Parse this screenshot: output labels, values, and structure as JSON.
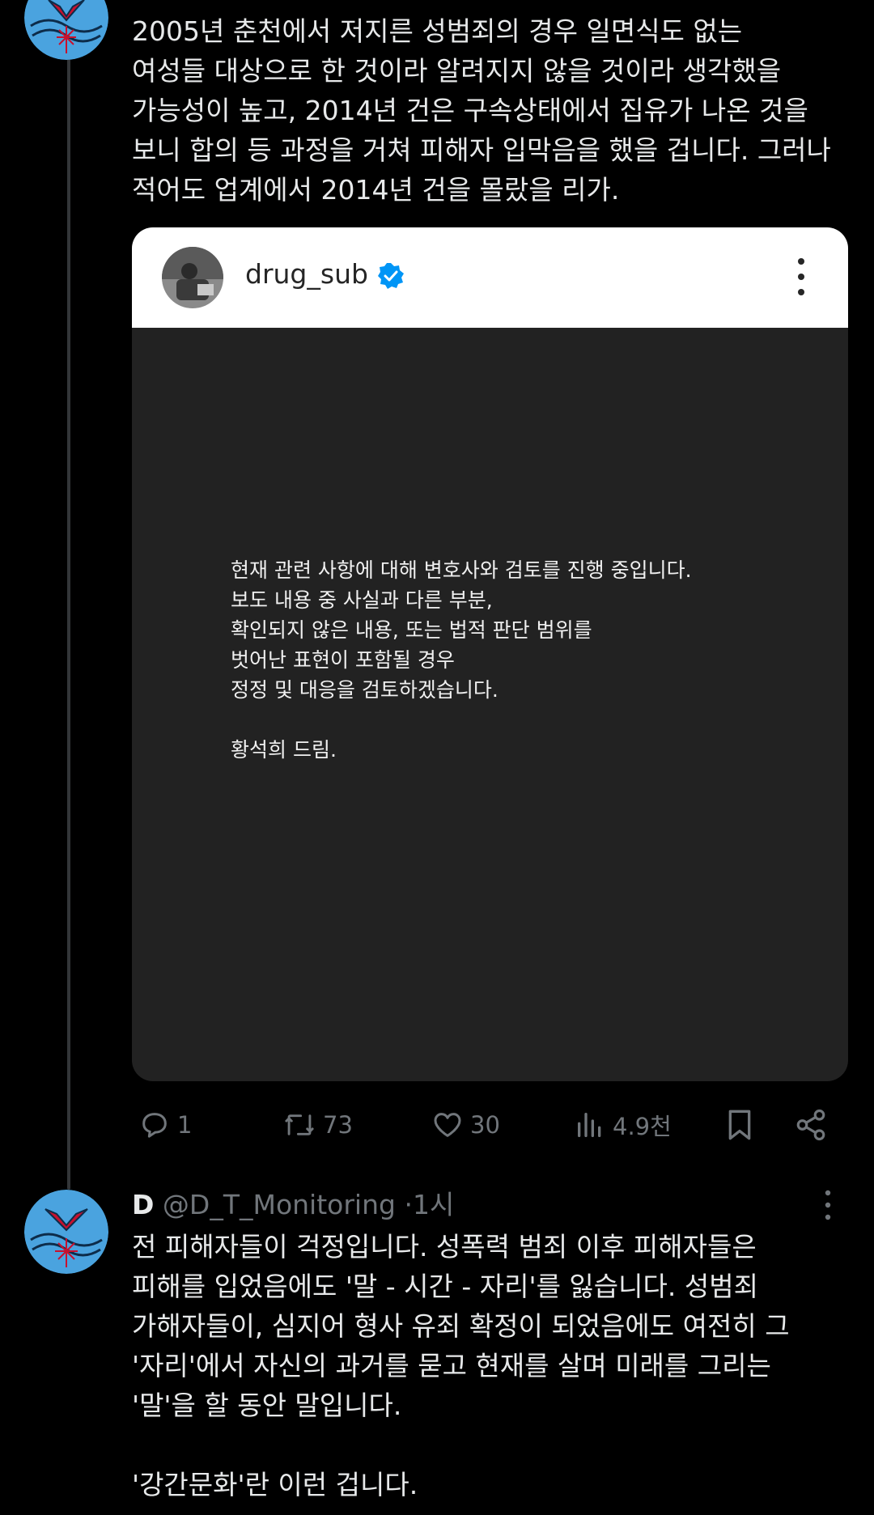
{
  "tweet1": {
    "text": "2005년 춘천에서 저지른 성범죄의 경우 일면식도 없는\n여성들 대상으로 한 것이라 알려지지 않을 것이라 생각했을\n가능성이 높고, 2014년 건은 구속상태에서 집유가 나온 것을\n보니 합의 등 과정을 거쳐 피해자 입막음을 했을 겁니다. 그러나\n적어도 업계에서 2014년 건을 몰랐을 리가.",
    "embed": {
      "username": "drug_sub",
      "statement": "현재 관련 사항에 대해 변호사와 검토를 진행 중입니다.\n보도 내용 중 사실과 다른 부분,\n확인되지 않은 내용, 또는 법적 판단 범위를\n벗어난 표현이 포함될 경우\n정정 및 대응을 검토하겠습니다.\n\n황석희 드림."
    },
    "actions": {
      "replies": "1",
      "retweets": "73",
      "likes": "30",
      "views": "4.9천"
    }
  },
  "tweet2": {
    "display_name": "D",
    "handle": "@D_T_Monitoring",
    "separator": "·",
    "time": "1시",
    "text": "전 피해자들이 걱정입니다. 성폭력 범죄 이후 피해자들은\n피해를 입었음에도 '말 - 시간 - 자리'를 잃습니다. 성범죄\n가해자들이, 심지어 형사 유죄 확정이 되었음에도 여전히 그\n'자리'에서 자신의 과거를 묻고 현재를 살며 미래를 그리는\n'말'을 할 동안 말입니다.\n\n'강간문화'란 이런 겁니다."
  },
  "colors": {
    "background": "#000000",
    "text": "#e7e9ea",
    "muted": "#71767b",
    "verified": "#0095f6",
    "avatar_bg": "#4aa3df",
    "avatar_accent": "#c8102e"
  },
  "icons": [
    "reply-icon",
    "retweet-icon",
    "like-icon",
    "views-icon",
    "bookmark-icon",
    "share-icon",
    "verified-badge-icon",
    "more-vertical-icon"
  ]
}
